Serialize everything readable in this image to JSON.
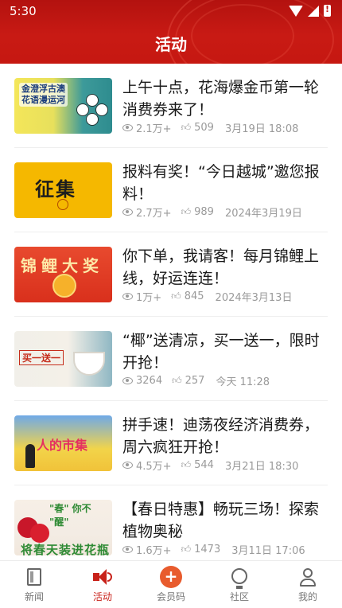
{
  "status_bar": {
    "time": "5:30"
  },
  "header": {
    "title": "活动"
  },
  "articles": [
    {
      "title": "上午十点，花海爆金币第一轮消费券来了！",
      "views": "2.1万+",
      "likes": "509",
      "date": "3月19日  18:08",
      "thumb_text": "金澄浮古澳\n花语漫运河"
    },
    {
      "title": "报料有奖！“今日越城”邀您报料！",
      "views": "2.7万+",
      "likes": "989",
      "date": "2024年3月19日",
      "thumb_text": "征集"
    },
    {
      "title": "你下单，我请客！每月锦鲤上线，好运连连！",
      "views": "1万+",
      "likes": "845",
      "date": "2024年3月13日",
      "thumb_text": "锦鲤大奖"
    },
    {
      "title": "“椰”送清凉，买一送一，限时开抢！",
      "views": "3264",
      "likes": "257",
      "date": "今天  11:28",
      "thumb_text": "买一送一"
    },
    {
      "title": "拼手速！迪荡夜经济消费券，周六疯狂开抢！",
      "views": "4.5万+",
      "likes": "544",
      "date": "3月21日  18:30",
      "thumb_text": "人的市集"
    },
    {
      "title": "【春日特惠】畅玩三场！探索植物奥秘",
      "views": "1.6万+",
      "likes": "1473",
      "date": "3月11日  17:06",
      "thumb_text": "将春天装进花瓶",
      "thumb_top_text": "\"春\" 你不 \"醒\""
    }
  ],
  "bottom_nav": {
    "items": [
      {
        "label": "新闻",
        "icon": "newspaper-icon",
        "active": false
      },
      {
        "label": "活动",
        "icon": "speaker-icon",
        "active": true
      },
      {
        "label": "会员码",
        "icon": "plus-circle-icon",
        "active": false
      },
      {
        "label": "社区",
        "icon": "lightbulb-icon",
        "active": false
      },
      {
        "label": "我的",
        "icon": "user-icon",
        "active": false
      }
    ]
  },
  "colors": {
    "header_red": "#c81a14",
    "active_red": "#c8221a",
    "meta_gray": "#9a9a9a"
  }
}
